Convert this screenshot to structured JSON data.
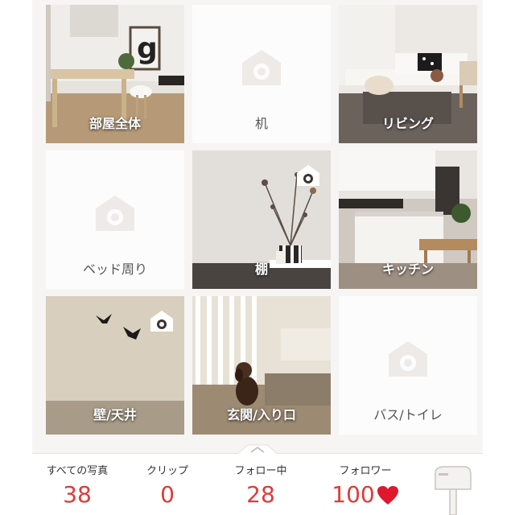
{
  "tiles": [
    {
      "label": "部屋全体",
      "kind": "photo",
      "icon": "none"
    },
    {
      "label": "机",
      "kind": "empty",
      "icon": "camera-house-icon"
    },
    {
      "label": "リビング",
      "kind": "photo",
      "icon": "none"
    },
    {
      "label": "ベッド周り",
      "kind": "empty",
      "icon": "camera-house-icon"
    },
    {
      "label": "棚",
      "kind": "photo",
      "icon": "camera-badge-icon"
    },
    {
      "label": "キッチン",
      "kind": "photo",
      "icon": "none"
    },
    {
      "label": "壁/天井",
      "kind": "photo",
      "icon": "camera-badge-icon"
    },
    {
      "label": "玄関/入り口",
      "kind": "photo",
      "icon": "none"
    },
    {
      "label": "バス/トイレ",
      "kind": "empty",
      "icon": "camera-house-icon"
    }
  ],
  "stats": {
    "all_photos": {
      "label": "すべての写真",
      "value": "38"
    },
    "clips": {
      "label": "クリップ",
      "value": "0"
    },
    "following": {
      "label": "フォロー中",
      "value": "28"
    },
    "followers": {
      "label": "フォロワー",
      "value": "100"
    }
  },
  "colors": {
    "accent": "#e03a3a",
    "heart": "#e0182d",
    "placeholder": "#eeeae7"
  },
  "icons": {
    "heart": "heart-icon",
    "mailbox": "mailbox-icon",
    "pull_tab": "chevron-up-icon"
  }
}
